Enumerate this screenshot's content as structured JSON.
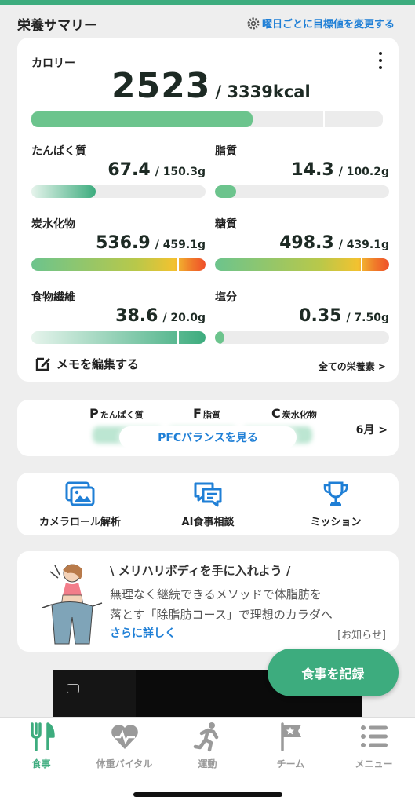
{
  "header": {
    "title": "栄養サマリー",
    "link_label": "曜日ごとに目標値を変更する"
  },
  "calorie": {
    "label": "カロリー",
    "value": "2523",
    "target": "/ 3339kcal",
    "progress": 0.63
  },
  "nutrients": [
    {
      "name": "たんぱく質",
      "value": "67.4",
      "target": "/ 150.3g",
      "progress": 0.37,
      "style": "fade"
    },
    {
      "name": "脂質",
      "value": "14.3",
      "target": "/ 100.2g",
      "progress": 0.12,
      "style": "green"
    },
    {
      "name": "炭水化物",
      "value": "536.9",
      "target": "/ 459.1g",
      "progress": 1.0,
      "style": "over"
    },
    {
      "name": "糖質",
      "value": "498.3",
      "target": "/ 439.1g",
      "progress": 1.0,
      "style": "over"
    },
    {
      "name": "食物繊維",
      "value": "38.6",
      "target": "/ 20.0g",
      "progress": 1.0,
      "style": "fade"
    },
    {
      "name": "塩分",
      "value": "0.35",
      "target": "/ 7.50g",
      "progress": 0.05,
      "style": "green"
    }
  ],
  "memo": {
    "label": "メモを編集する"
  },
  "all_nutrients": {
    "label": "全ての栄養素 >"
  },
  "pfc": {
    "items": [
      {
        "letter": "P",
        "name": "たんぱく質"
      },
      {
        "letter": "F",
        "name": "脂質"
      },
      {
        "letter": "C",
        "name": "炭水化物"
      }
    ],
    "button_label": "PFCバランスを見る",
    "month_label": "6月 >"
  },
  "features": [
    {
      "label": "カメラロール解析",
      "icon": "image-gallery-icon"
    },
    {
      "label": "AI食事相談",
      "icon": "chat-icon"
    },
    {
      "label": "ミッション",
      "icon": "trophy-icon"
    }
  ],
  "news": {
    "title": "\\ メリハリボディを手に入れよう /",
    "body_line1": "無理なく継続できるメソッドで体脂肪を",
    "body_line2": "落とす「除脂肪コース」で理想のカラダへ",
    "more_label": "さらに詳しく",
    "tag": "[お知らせ]"
  },
  "fab": {
    "label": "食事を記録"
  },
  "tabs": [
    {
      "label": "食事",
      "icon": "fork-knife-icon",
      "active": true
    },
    {
      "label": "体重バイタル",
      "icon": "heart-pulse-icon",
      "active": false
    },
    {
      "label": "運動",
      "icon": "running-icon",
      "active": false
    },
    {
      "label": "チーム",
      "icon": "flag-icon",
      "active": false
    },
    {
      "label": "メニュー",
      "icon": "menu-list-icon",
      "active": false
    }
  ],
  "colors": {
    "brand_green": "#3dac7e",
    "link_blue": "#1f7fd6",
    "over_orange": "#f07a2a"
  }
}
